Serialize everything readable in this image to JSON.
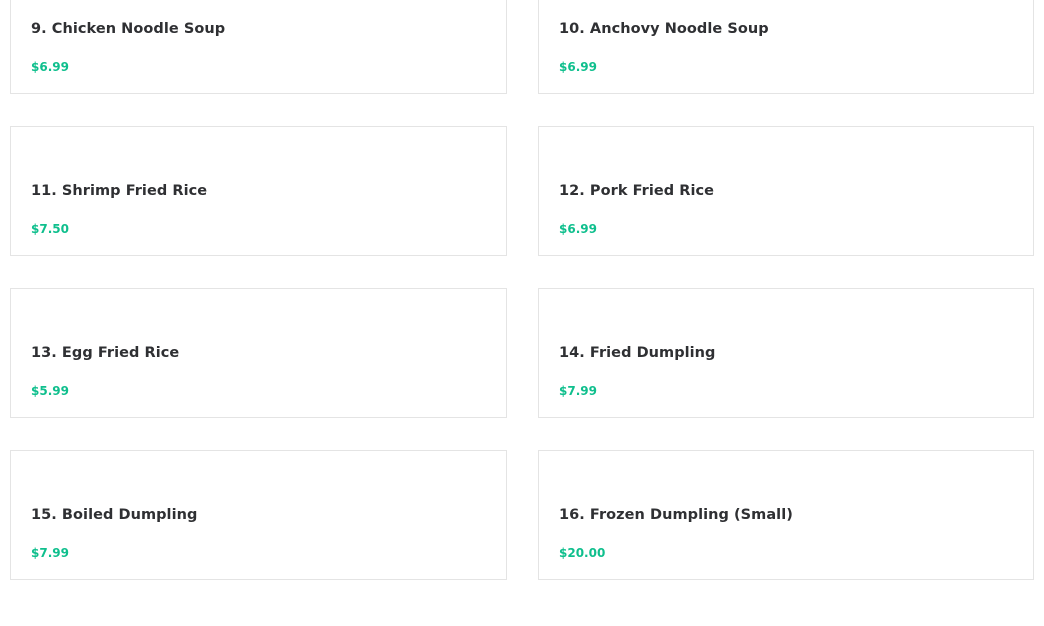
{
  "menu": {
    "items": [
      {
        "name": "9. Chicken Noodle Soup",
        "price": "$6.99"
      },
      {
        "name": "10. Anchovy Noodle Soup",
        "price": "$6.99"
      },
      {
        "name": "11. Shrimp Fried Rice",
        "price": "$7.50"
      },
      {
        "name": "12. Pork Fried Rice",
        "price": "$6.99"
      },
      {
        "name": "13. Egg Fried Rice",
        "price": "$5.99"
      },
      {
        "name": "14. Fried Dumpling",
        "price": "$7.99"
      },
      {
        "name": "15. Boiled Dumpling",
        "price": "$7.99"
      },
      {
        "name": "16. Frozen Dumpling (Small)",
        "price": "$20.00"
      }
    ]
  },
  "colors": {
    "price": "#0fbf8d",
    "title": "#2f3033",
    "card_border": "#e4e4e4"
  }
}
